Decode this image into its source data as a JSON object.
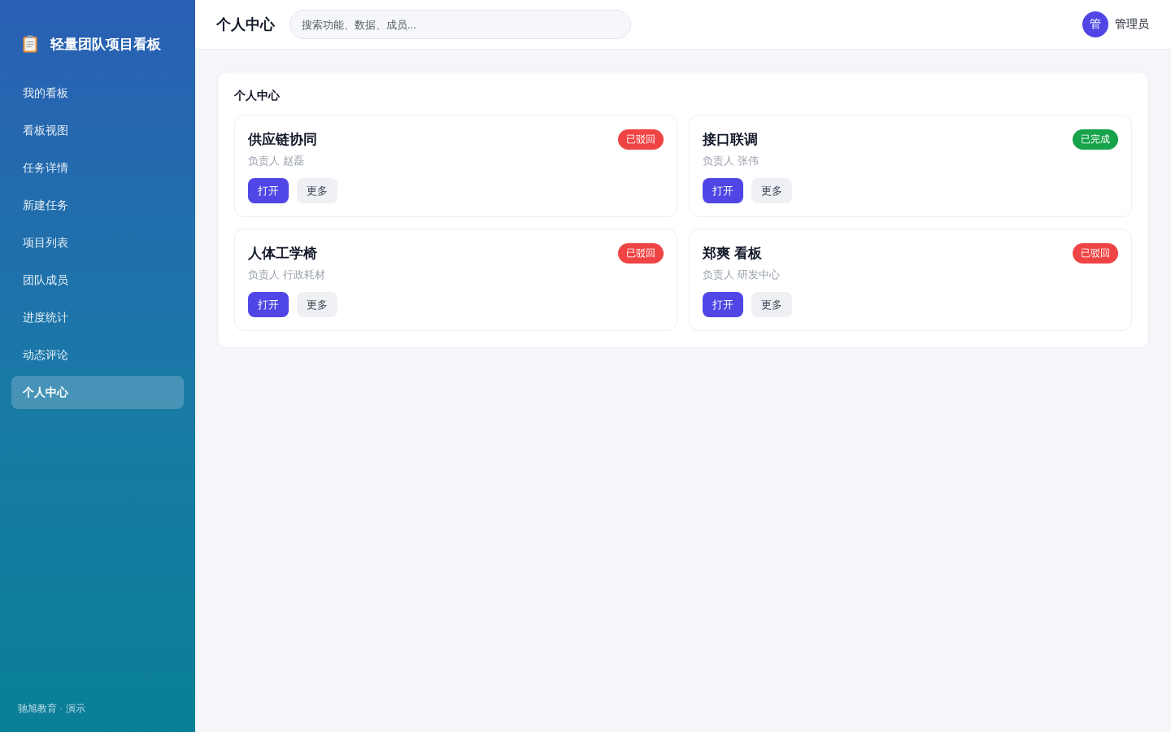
{
  "sidebar": {
    "brand": "轻量团队项目看板",
    "items": [
      {
        "label": "我的看板",
        "selected": false
      },
      {
        "label": "看板视图",
        "selected": false
      },
      {
        "label": "任务详情",
        "selected": false
      },
      {
        "label": "新建任务",
        "selected": false
      },
      {
        "label": "项目列表",
        "selected": false
      },
      {
        "label": "团队成员",
        "selected": false
      },
      {
        "label": "进度统计",
        "selected": false
      },
      {
        "label": "动态评论",
        "selected": false
      },
      {
        "label": "个人中心",
        "selected": true
      }
    ],
    "footer": "驰旭教育 · 演示"
  },
  "header": {
    "title": "个人中心",
    "search": {
      "placeholder": "搜索功能、数据、成员..."
    },
    "user": {
      "avatar": "管",
      "name": "管理员"
    }
  },
  "panel": {
    "title": "个人中心",
    "cards": [
      {
        "title": "供应链协同",
        "owner": "负责人 赵磊",
        "status": {
          "label": "已驳回",
          "color": "#ef4444"
        },
        "buttons": [
          "打开",
          "更多"
        ]
      },
      {
        "title": "接口联调",
        "owner": "负责人 张伟",
        "status": {
          "label": "已完成",
          "color": "#16a34a"
        },
        "buttons": [
          "打开",
          "更多"
        ]
      },
      {
        "title": "人体工学椅",
        "owner": "负责人 行政耗材",
        "status": {
          "label": "已驳回",
          "color": "#ef4444"
        },
        "buttons": [
          "打开",
          "更多"
        ]
      },
      {
        "title": "郑爽 看板",
        "owner": "负责人 研发中心",
        "status": {
          "label": "已驳回",
          "color": "#ef4444"
        },
        "buttons": [
          "打开",
          "更多"
        ]
      }
    ]
  }
}
